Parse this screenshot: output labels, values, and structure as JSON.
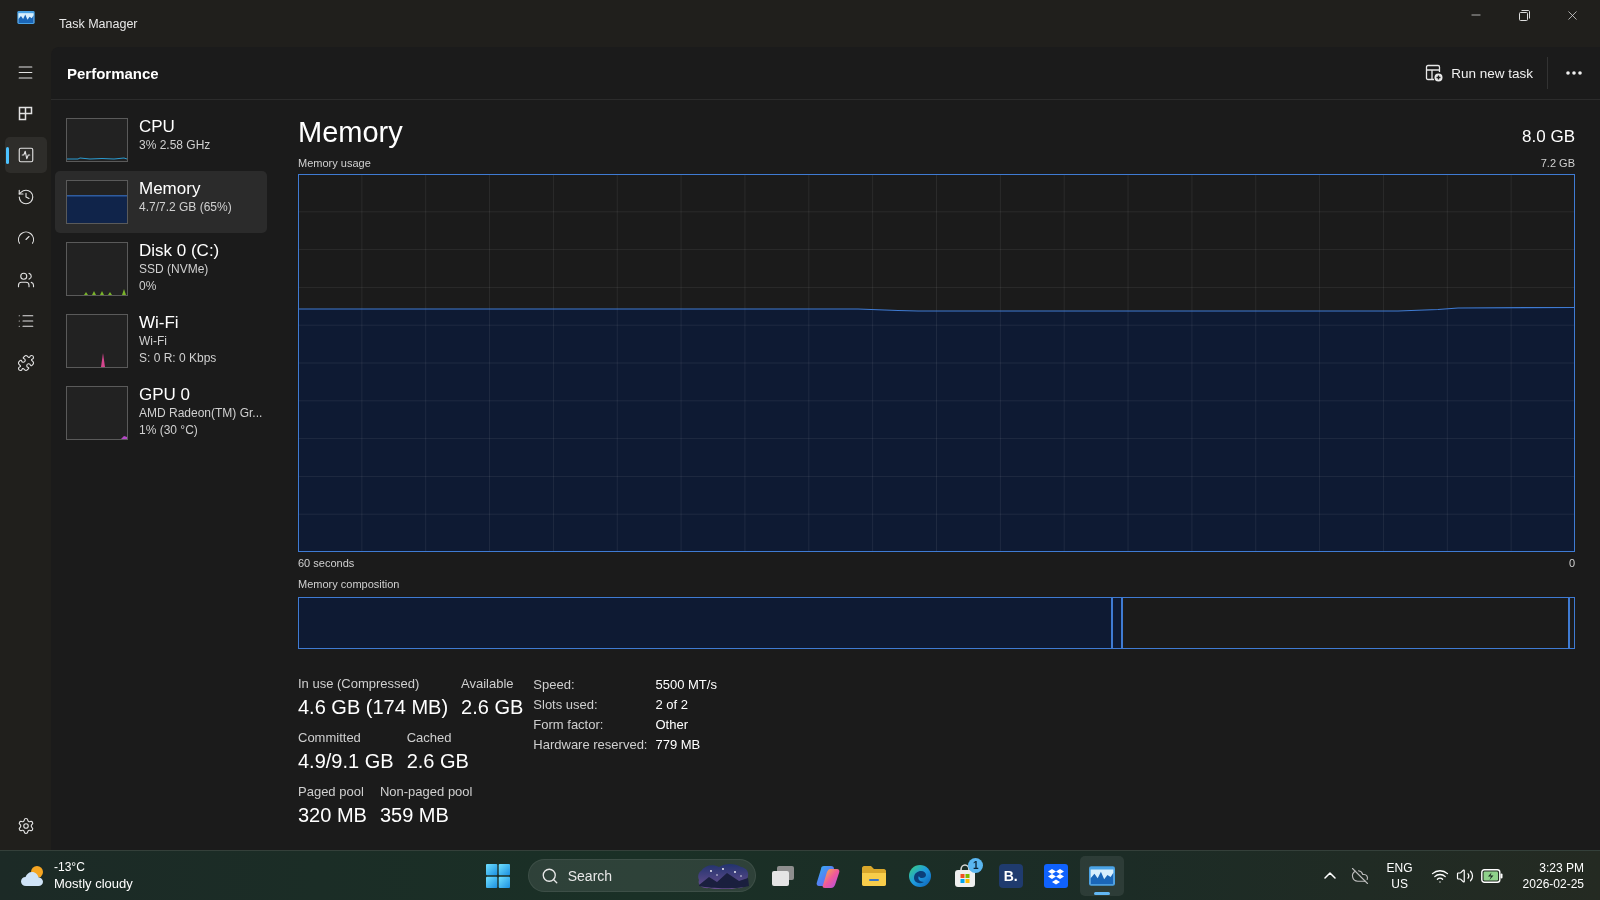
{
  "window": {
    "title": "Task Manager"
  },
  "nav": {
    "items": [
      {
        "selected": false
      },
      {
        "selected": true
      },
      {
        "selected": false
      },
      {
        "selected": false
      },
      {
        "selected": false
      },
      {
        "selected": false
      },
      {
        "selected": false
      }
    ]
  },
  "header": {
    "title": "Performance",
    "action": "Run new task"
  },
  "resources": [
    {
      "kind": "cpu",
      "name": "CPU",
      "details": [
        "3% 2.58 GHz"
      ],
      "selected": false
    },
    {
      "kind": "memory",
      "name": "Memory",
      "details": [
        "4.7/7.2 GB (65%)"
      ],
      "selected": true
    },
    {
      "kind": "disk",
      "name": "Disk 0 (C:)",
      "details": [
        "SSD (NVMe)",
        "0%"
      ],
      "selected": false
    },
    {
      "kind": "network",
      "name": "Wi-Fi",
      "details": [
        "Wi-Fi",
        "S: 0 R: 0 Kbps"
      ],
      "selected": false
    },
    {
      "kind": "gpu",
      "name": "GPU 0",
      "details": [
        "AMD Radeon(TM) Gr...",
        "1% (30 °C)"
      ],
      "selected": false
    }
  ],
  "memory": {
    "title": "Memory",
    "total": "8.0 GB",
    "usage_label": "Memory usage",
    "usage_max": "7.2 GB",
    "span_start": "60 seconds",
    "span_end": "0",
    "composition_label": "Memory composition",
    "stat_rows": [
      [
        {
          "label": "In use (Compressed)",
          "value": "4.6 GB (174 MB)"
        },
        {
          "label": "Available",
          "value": "2.6 GB"
        }
      ],
      [
        {
          "label": "Committed",
          "value": "4.9/9.1 GB"
        },
        {
          "label": "Cached",
          "value": "2.6 GB"
        }
      ],
      [
        {
          "label": "Paged pool",
          "value": "320 MB"
        },
        {
          "label": "Non-paged pool",
          "value": "359 MB"
        }
      ]
    ],
    "specs": [
      {
        "label": "Speed:",
        "value": "5500 MT/s"
      },
      {
        "label": "Slots used:",
        "value": "2 of 2"
      },
      {
        "label": "Form factor:",
        "value": "Other"
      },
      {
        "label": "Hardware reserved:",
        "value": "779 MB"
      }
    ]
  },
  "taskbar": {
    "weather": {
      "temperature": "-13°C",
      "condition": "Mostly cloudy"
    },
    "search": {
      "placeholder": "Search"
    },
    "apps": [
      {
        "kind": "desktops",
        "selected": false
      },
      {
        "kind": "tiles",
        "selected": false
      },
      {
        "kind": "folder",
        "selected": false
      },
      {
        "kind": "browser",
        "selected": false
      },
      {
        "kind": "bag",
        "badge": "1",
        "selected": false
      },
      {
        "kind": "letter",
        "label": "B.",
        "selected": false
      },
      {
        "kind": "box",
        "selected": false
      },
      {
        "kind": "monitor",
        "selected": true
      }
    ],
    "tray": {
      "language": "ENG",
      "region": "US",
      "time": "3:23 PM",
      "date": "2026-02-25"
    }
  }
}
